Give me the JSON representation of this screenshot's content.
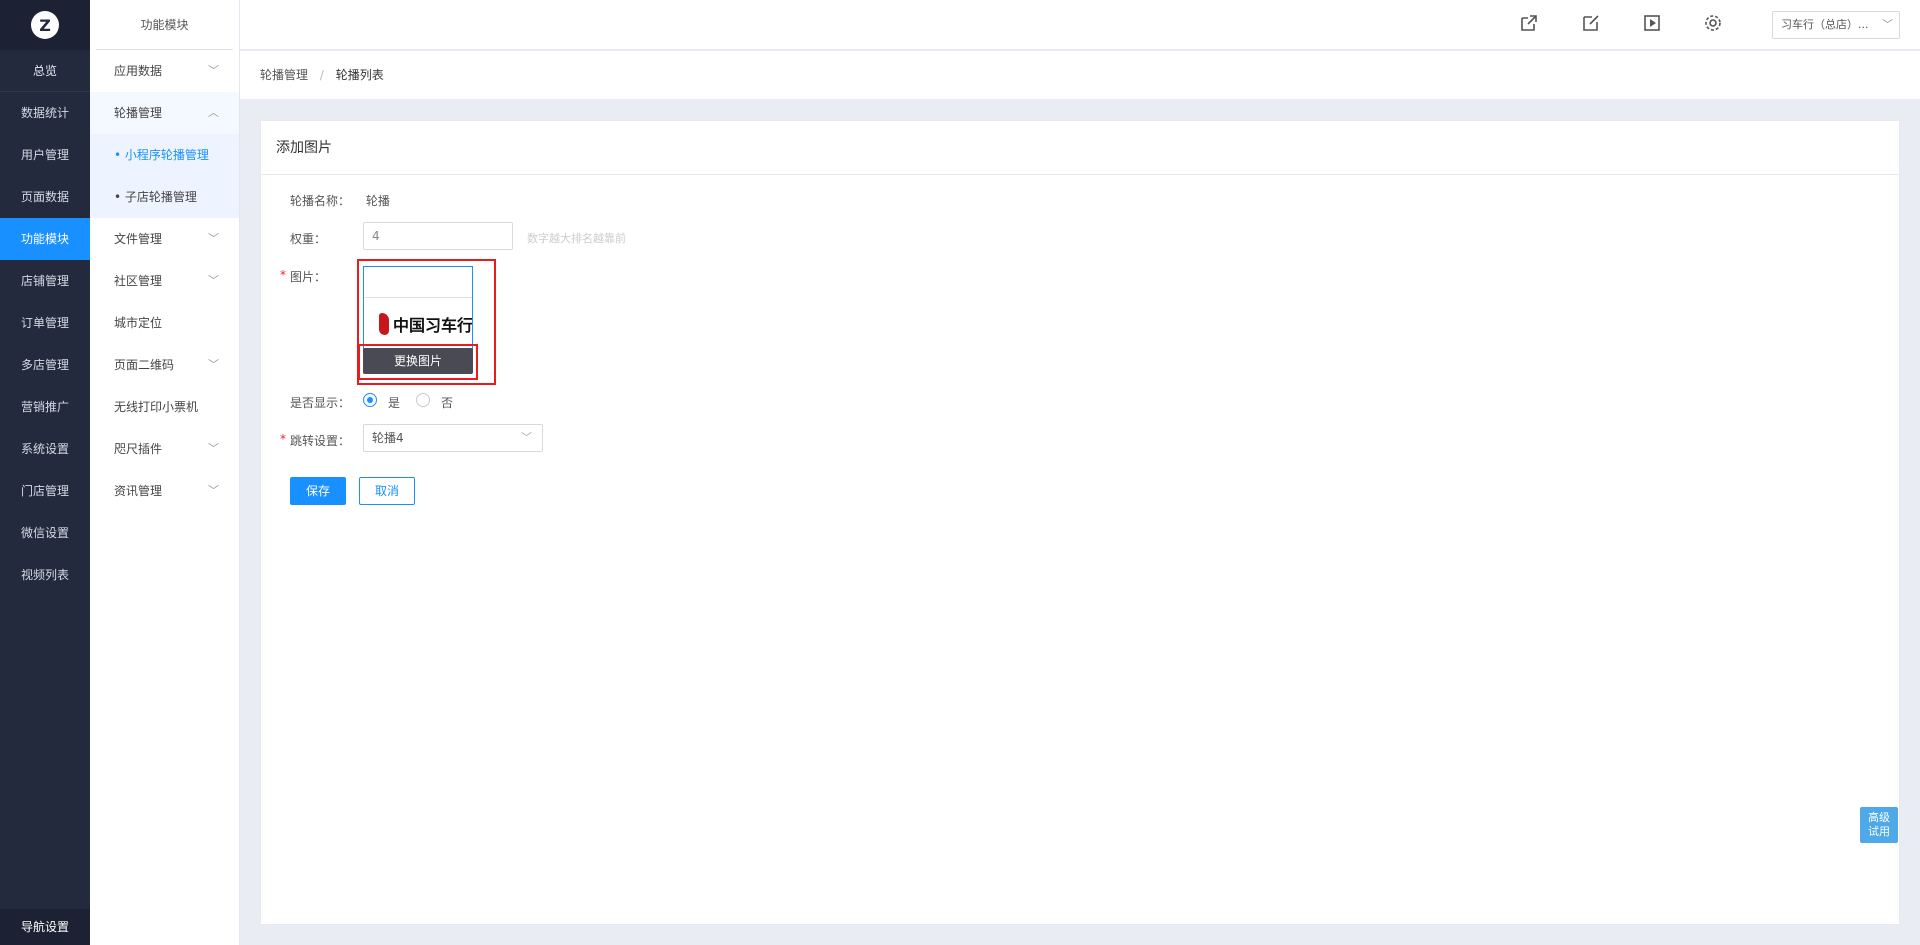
{
  "logo": {
    "glyph": "Z"
  },
  "sidebar": {
    "overview": "总览",
    "items": [
      {
        "label": "数据统计"
      },
      {
        "label": "用户管理"
      },
      {
        "label": "页面数据"
      },
      {
        "label": "功能模块",
        "active": true
      },
      {
        "label": "店铺管理"
      },
      {
        "label": "订单管理"
      },
      {
        "label": "多店管理"
      },
      {
        "label": "营销推广"
      },
      {
        "label": "系统设置"
      },
      {
        "label": "门店管理"
      },
      {
        "label": "微信设置"
      },
      {
        "label": "视频列表"
      }
    ],
    "bottom": "导航设置"
  },
  "subnav": {
    "title": "功能模块",
    "items": [
      {
        "label": "应用数据",
        "chevron": "chevron-down"
      },
      {
        "label": "轮播管理",
        "chevron": "chevron-up"
      },
      {
        "label": "• 小程序轮播管理"
      },
      {
        "label": "• 子店轮播管理"
      },
      {
        "label": "文件管理",
        "chevron": "chevron-down"
      },
      {
        "label": "社区管理",
        "chevron": "chevron-down"
      },
      {
        "label": "城市定位"
      },
      {
        "label": "页面二维码",
        "chevron": "chevron-down"
      },
      {
        "label": "无线打印小票机"
      },
      {
        "label": "咫尺插件",
        "chevron": "chevron-down"
      },
      {
        "label": "资讯管理",
        "chevron": "chevron-down"
      }
    ]
  },
  "topbar": {
    "icons": [
      "external-link-icon",
      "edit-icon",
      "play-icon",
      "gear-icon"
    ],
    "store_select": "习车行（总店）..."
  },
  "breadcrumb": {
    "parent": "轮播管理",
    "separator": "/",
    "current": "轮播列表"
  },
  "form": {
    "title": "添加图片",
    "name_label": "轮播名称：",
    "name_value": "轮播",
    "weight_label": "权重：",
    "weight_value": "4",
    "weight_hint": "数字越大排名越靠前",
    "image_label": "图片：",
    "image_logo_text": "中国习车行",
    "change_image": "更换图片",
    "show_label": "是否显示：",
    "show_yes": "是",
    "show_no": "否",
    "show_selected": "是",
    "jump_label": "跳转设置：",
    "jump_value": "轮播4",
    "save": "保存",
    "cancel": "取消",
    "required_mark": "*"
  },
  "trial_badge": {
    "line1": "高级",
    "line2": "试用"
  },
  "colors": {
    "accent": "#1890ff",
    "sidebar_bg": "#232a3d",
    "highlight": "#e81c1c"
  }
}
